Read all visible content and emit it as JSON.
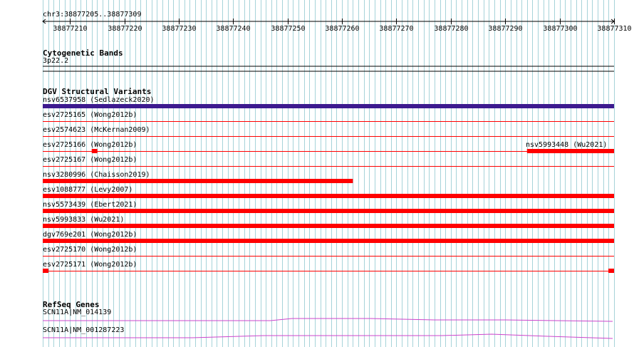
{
  "ruler": {
    "coord_label": "chr3:38877205..38877309",
    "tick_labels": [
      "38877210",
      "38877220",
      "38877230",
      "38877240",
      "38877250",
      "38877260",
      "38877270",
      "38877280",
      "38877290",
      "38877300",
      "38877310"
    ]
  },
  "colors": {
    "grid_line": "#a6d3d9",
    "dgv_feature": "#ff0000",
    "dgv_highlight": "#3d1a8f",
    "gene_line": "#cc44cc"
  },
  "tracks": {
    "cytoband": {
      "title": "Cytogenetic Bands",
      "band_label": "3p22.2"
    },
    "dgv": {
      "title": "DGV Structural Variants",
      "features": [
        {
          "label": "nsv6537958 (Sedlazeck2020)",
          "start": 38877205,
          "end": 38877309,
          "style": "thick",
          "color": "#3d1a8f"
        },
        {
          "label": "esv2725165 (Wong2012b)",
          "start": 38877205,
          "end": 38877309,
          "style": "thin",
          "color": "#ff0000"
        },
        {
          "label": "esv2574623 (McKernan2009)",
          "start": 38877205,
          "end": 38877309,
          "style": "thin",
          "color": "#ff0000"
        },
        {
          "label": "esv2725166 (Wong2012b)",
          "start": 38877205,
          "end": 38877309,
          "style": "blocks",
          "color": "#ff0000"
        },
        {
          "label": "nsv5993448 (Wu2021)",
          "start": 38877294,
          "end": 38877309,
          "style": "thick",
          "color": "#ff0000"
        },
        {
          "label": "esv2725167 (Wong2012b)",
          "start": 38877205,
          "end": 38877309,
          "style": "thin",
          "color": "#ff0000"
        },
        {
          "label": "nsv3280996 (Chaisson2019)",
          "start": 38877205,
          "end": 38877261,
          "style": "thick",
          "color": "#ff0000"
        },
        {
          "label": "esv1088777 (Levy2007)",
          "start": 38877205,
          "end": 38877309,
          "style": "thick",
          "color": "#ff0000"
        },
        {
          "label": "nsv5573439 (Ebert2021)",
          "start": 38877205,
          "end": 38877309,
          "style": "thick",
          "color": "#ff0000"
        },
        {
          "label": "nsv5993833 (Wu2021)",
          "start": 38877205,
          "end": 38877309,
          "style": "thick",
          "color": "#ff0000"
        },
        {
          "label": "dgv769e201 (Wong2012b)",
          "start": 38877205,
          "end": 38877309,
          "style": "thick",
          "color": "#ff0000"
        },
        {
          "label": "esv2725170 (Wong2012b)",
          "start": 38877205,
          "end": 38877309,
          "style": "thin",
          "color": "#ff0000"
        },
        {
          "label": "esv2725171 (Wong2012b)",
          "start": 38877205,
          "end": 38877309,
          "style": "blocks",
          "color": "#ff0000"
        }
      ]
    },
    "refseq": {
      "title": "RefSeq Genes",
      "genes": [
        {
          "label": "SCN11A|NM_014139"
        },
        {
          "label": "SCN11A|NM_001287223"
        }
      ]
    }
  }
}
